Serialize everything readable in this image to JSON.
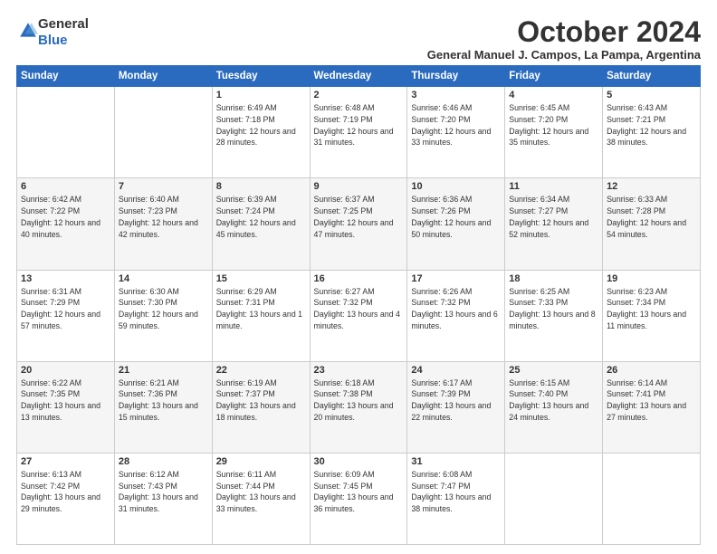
{
  "logo": {
    "general": "General",
    "blue": "Blue"
  },
  "header": {
    "month": "October 2024",
    "location": "General Manuel J. Campos, La Pampa, Argentina"
  },
  "weekdays": [
    "Sunday",
    "Monday",
    "Tuesday",
    "Wednesday",
    "Thursday",
    "Friday",
    "Saturday"
  ],
  "weeks": [
    [
      {
        "day": "",
        "info": ""
      },
      {
        "day": "",
        "info": ""
      },
      {
        "day": "1",
        "info": "Sunrise: 6:49 AM\nSunset: 7:18 PM\nDaylight: 12 hours and 28 minutes."
      },
      {
        "day": "2",
        "info": "Sunrise: 6:48 AM\nSunset: 7:19 PM\nDaylight: 12 hours and 31 minutes."
      },
      {
        "day": "3",
        "info": "Sunrise: 6:46 AM\nSunset: 7:20 PM\nDaylight: 12 hours and 33 minutes."
      },
      {
        "day": "4",
        "info": "Sunrise: 6:45 AM\nSunset: 7:20 PM\nDaylight: 12 hours and 35 minutes."
      },
      {
        "day": "5",
        "info": "Sunrise: 6:43 AM\nSunset: 7:21 PM\nDaylight: 12 hours and 38 minutes."
      }
    ],
    [
      {
        "day": "6",
        "info": "Sunrise: 6:42 AM\nSunset: 7:22 PM\nDaylight: 12 hours and 40 minutes."
      },
      {
        "day": "7",
        "info": "Sunrise: 6:40 AM\nSunset: 7:23 PM\nDaylight: 12 hours and 42 minutes."
      },
      {
        "day": "8",
        "info": "Sunrise: 6:39 AM\nSunset: 7:24 PM\nDaylight: 12 hours and 45 minutes."
      },
      {
        "day": "9",
        "info": "Sunrise: 6:37 AM\nSunset: 7:25 PM\nDaylight: 12 hours and 47 minutes."
      },
      {
        "day": "10",
        "info": "Sunrise: 6:36 AM\nSunset: 7:26 PM\nDaylight: 12 hours and 50 minutes."
      },
      {
        "day": "11",
        "info": "Sunrise: 6:34 AM\nSunset: 7:27 PM\nDaylight: 12 hours and 52 minutes."
      },
      {
        "day": "12",
        "info": "Sunrise: 6:33 AM\nSunset: 7:28 PM\nDaylight: 12 hours and 54 minutes."
      }
    ],
    [
      {
        "day": "13",
        "info": "Sunrise: 6:31 AM\nSunset: 7:29 PM\nDaylight: 12 hours and 57 minutes."
      },
      {
        "day": "14",
        "info": "Sunrise: 6:30 AM\nSunset: 7:30 PM\nDaylight: 12 hours and 59 minutes."
      },
      {
        "day": "15",
        "info": "Sunrise: 6:29 AM\nSunset: 7:31 PM\nDaylight: 13 hours and 1 minute."
      },
      {
        "day": "16",
        "info": "Sunrise: 6:27 AM\nSunset: 7:32 PM\nDaylight: 13 hours and 4 minutes."
      },
      {
        "day": "17",
        "info": "Sunrise: 6:26 AM\nSunset: 7:32 PM\nDaylight: 13 hours and 6 minutes."
      },
      {
        "day": "18",
        "info": "Sunrise: 6:25 AM\nSunset: 7:33 PM\nDaylight: 13 hours and 8 minutes."
      },
      {
        "day": "19",
        "info": "Sunrise: 6:23 AM\nSunset: 7:34 PM\nDaylight: 13 hours and 11 minutes."
      }
    ],
    [
      {
        "day": "20",
        "info": "Sunrise: 6:22 AM\nSunset: 7:35 PM\nDaylight: 13 hours and 13 minutes."
      },
      {
        "day": "21",
        "info": "Sunrise: 6:21 AM\nSunset: 7:36 PM\nDaylight: 13 hours and 15 minutes."
      },
      {
        "day": "22",
        "info": "Sunrise: 6:19 AM\nSunset: 7:37 PM\nDaylight: 13 hours and 18 minutes."
      },
      {
        "day": "23",
        "info": "Sunrise: 6:18 AM\nSunset: 7:38 PM\nDaylight: 13 hours and 20 minutes."
      },
      {
        "day": "24",
        "info": "Sunrise: 6:17 AM\nSunset: 7:39 PM\nDaylight: 13 hours and 22 minutes."
      },
      {
        "day": "25",
        "info": "Sunrise: 6:15 AM\nSunset: 7:40 PM\nDaylight: 13 hours and 24 minutes."
      },
      {
        "day": "26",
        "info": "Sunrise: 6:14 AM\nSunset: 7:41 PM\nDaylight: 13 hours and 27 minutes."
      }
    ],
    [
      {
        "day": "27",
        "info": "Sunrise: 6:13 AM\nSunset: 7:42 PM\nDaylight: 13 hours and 29 minutes."
      },
      {
        "day": "28",
        "info": "Sunrise: 6:12 AM\nSunset: 7:43 PM\nDaylight: 13 hours and 31 minutes."
      },
      {
        "day": "29",
        "info": "Sunrise: 6:11 AM\nSunset: 7:44 PM\nDaylight: 13 hours and 33 minutes."
      },
      {
        "day": "30",
        "info": "Sunrise: 6:09 AM\nSunset: 7:45 PM\nDaylight: 13 hours and 36 minutes."
      },
      {
        "day": "31",
        "info": "Sunrise: 6:08 AM\nSunset: 7:47 PM\nDaylight: 13 hours and 38 minutes."
      },
      {
        "day": "",
        "info": ""
      },
      {
        "day": "",
        "info": ""
      }
    ]
  ]
}
